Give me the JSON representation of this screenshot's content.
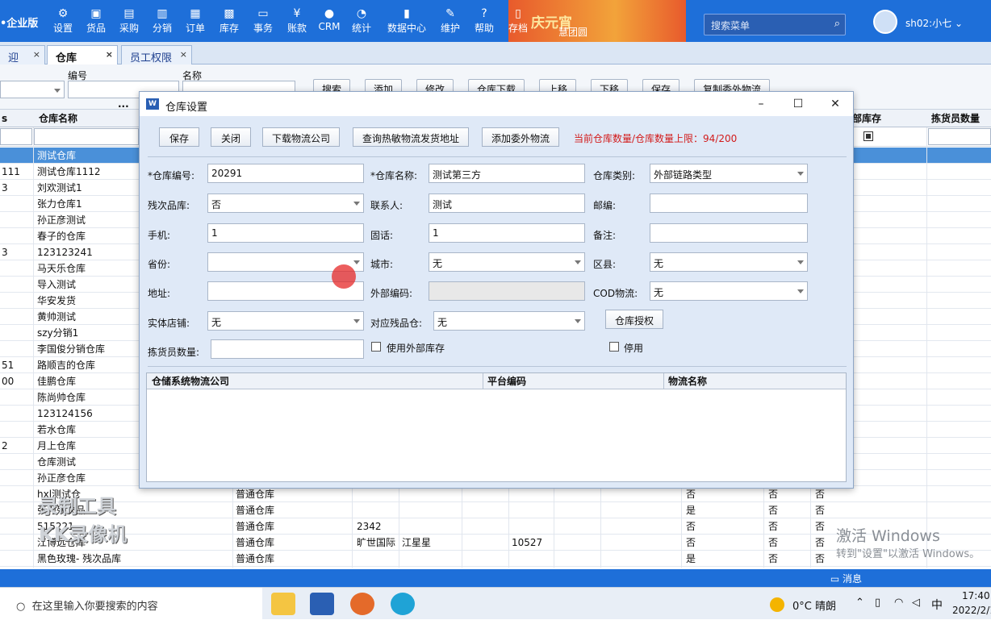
{
  "topbar": {
    "brand": "•企业版",
    "items": [
      "设置",
      "货品",
      "采购",
      "分销",
      "订单",
      "库存",
      "事务",
      "账款",
      "CRM",
      "统计",
      "数据中心",
      "维护",
      "帮助",
      "存档"
    ],
    "icons": [
      "gear-icon",
      "cube-icon",
      "cart-icon",
      "distribute-icon",
      "order-icon",
      "grid-icon",
      "chat-icon",
      "yen-icon",
      "person-icon",
      "pie-icon",
      "bars-icon",
      "wrench-icon",
      "help-icon",
      "archive-icon"
    ],
    "banner_text": "庆元宵",
    "banner_caption": "慧团圆",
    "search_placeholder": "搜索菜单",
    "username": "sh02:小七"
  },
  "tabs": [
    {
      "label": "迎"
    },
    {
      "label": "仓库"
    },
    {
      "label": "员工权限"
    }
  ],
  "filter": {
    "code_label": "编号",
    "name_label": "名称",
    "ellipsis": "...",
    "buttons": [
      "搜索",
      "添加",
      "修改",
      "仓库下载",
      "上移",
      "下移",
      "保存",
      "复制委外物流"
    ]
  },
  "grid": {
    "headers": {
      "c0": "s",
      "name": "仓库名称",
      "local": "部库存",
      "picker": "拣货员数量"
    },
    "rows": [
      {
        "c0": "",
        "name": "测试仓库"
      },
      {
        "c0": "111",
        "name": "测试仓库1112"
      },
      {
        "c0": "3",
        "name": "刘欢测试1"
      },
      {
        "c0": "",
        "name": "张力仓库1"
      },
      {
        "c0": "",
        "name": "孙正彦测试"
      },
      {
        "c0": "",
        "name": "春子的仓库"
      },
      {
        "c0": "3",
        "name": "123123241"
      },
      {
        "c0": "",
        "name": "马天乐仓库"
      },
      {
        "c0": "",
        "name": "导入测试"
      },
      {
        "c0": "",
        "name": "华安发货"
      },
      {
        "c0": "",
        "name": "黄帅测试"
      },
      {
        "c0": "",
        "name": "szy分销1"
      },
      {
        "c0": "",
        "name": "李国俊分销仓库"
      },
      {
        "c0": "51",
        "name": "路顺吉的仓库"
      },
      {
        "c0": "00",
        "name": "佳鹏仓库"
      },
      {
        "c0": "",
        "name": "陈尚帅仓库"
      },
      {
        "c0": "",
        "name": "123124156"
      },
      {
        "c0": "",
        "name": "若水仓库"
      },
      {
        "c0": "2",
        "name": "月上仓库"
      },
      {
        "c0": "",
        "name": "仓库测试"
      },
      {
        "c0": "",
        "name": "孙正彦仓库"
      },
      {
        "c0": "",
        "name": "hxl测试仓",
        "type": "普通仓库",
        "x1": "否",
        "x2": "否",
        "x3": "否"
      },
      {
        "c0": "",
        "name": "张力残次品",
        "type": "普通仓库",
        "x1": "是",
        "x2": "否",
        "x3": "否"
      },
      {
        "c0": "",
        "name": "515221",
        "type": "普通仓库",
        "v1": "2342",
        "x1": "否",
        "x2": "否",
        "x3": "否"
      },
      {
        "c0": "",
        "name": "江博远仓库",
        "type": "普通仓库",
        "v1": "旷世国际",
        "v2": "江星星",
        "v3": "10527",
        "x1": "否",
        "x2": "否",
        "x3": "否"
      },
      {
        "c0": "",
        "name": "黑色玫瑰- 残次品库",
        "type": "普通仓库",
        "x1": "是",
        "x2": "否",
        "x3": "否"
      }
    ]
  },
  "dialog": {
    "title": "仓库设置",
    "icon_letter": "W",
    "buttons": [
      "保存",
      "关闭",
      "下载物流公司",
      "查询热敏物流发货地址",
      "添加委外物流"
    ],
    "limit_text": "当前仓库数量/仓库数量上限：94/200",
    "fields": {
      "code_label": "*仓库编号:",
      "code_value": "20291",
      "name_label": "*仓库名称:",
      "name_value": "测试第三方",
      "type_label": "仓库类别:",
      "type_value": "外部链路类型",
      "defect_label": "残次品库:",
      "defect_value": "否",
      "contact_label": "联系人:",
      "contact_value": "测试",
      "zip_label": "邮编:",
      "zip_value": "",
      "mobile_label": "手机:",
      "mobile_value": "1",
      "phone_label": "固话:",
      "phone_value": "1",
      "note_label": "备注:",
      "note_value": "",
      "province_label": "省份:",
      "province_value": "",
      "city_label": "城市:",
      "city_value": "无",
      "district_label": "区县:",
      "district_value": "无",
      "address_label": "地址:",
      "address_value": "",
      "extcode_label": "外部编码:",
      "extcode_value": "",
      "cod_label": "COD物流:",
      "cod_value": "无",
      "store_label": "实体店铺:",
      "store_value": "无",
      "defectwh_label": "对应残品仓:",
      "defectwh_value": "无",
      "auth_button": "仓库授权",
      "picker_label": "拣货员数量:",
      "picker_value": "",
      "use_ext_label": "使用外部库存",
      "disable_label": "停用"
    },
    "list_headers": [
      "仓储系统物流公司",
      "平台编码",
      "物流名称"
    ]
  },
  "status": {
    "message": "消息"
  },
  "windows": {
    "activate_title": "激活 Windows",
    "activate_sub": "转到\"设置\"以激活 Windows。"
  },
  "watermark": {
    "line1": "录制工具",
    "line2": "KK录像机"
  },
  "taskbar": {
    "search_placeholder": "在这里输入你要搜索的内容",
    "weather": "0°C  晴朗",
    "ime": "中",
    "time": "17:40",
    "date": "2022/2/1"
  }
}
